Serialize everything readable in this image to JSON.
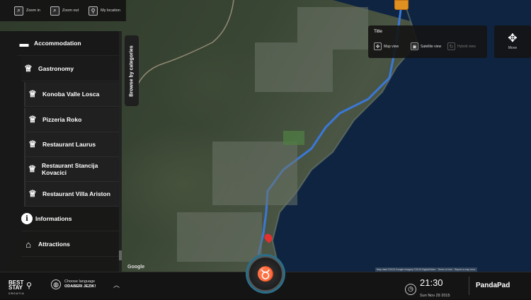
{
  "toolbar": {
    "zoom_in_label": "Zoom in",
    "zoom_out_label": "Zoom out",
    "my_location_label": "My location"
  },
  "sidebar": {
    "items": [
      {
        "label": "Accommodation",
        "icon": "bed-icon",
        "glyph": "🛏"
      },
      {
        "label": "Gastronomy",
        "icon": "chef-hat-icon",
        "glyph": "♕"
      },
      {
        "label": "Konoba Valle Losca",
        "icon": "chef-hat-icon",
        "glyph": "♕"
      },
      {
        "label": "Pizzeria Roko",
        "icon": "chef-hat-icon",
        "glyph": "♕"
      },
      {
        "label": "Restaurant Laurus",
        "icon": "chef-hat-icon",
        "glyph": "♕"
      },
      {
        "label": "Restaurant Stancija Kovacici",
        "icon": "chef-hat-icon",
        "glyph": "♕"
      },
      {
        "label": "Restaurant Villa Ariston",
        "icon": "chef-hat-icon",
        "glyph": "♕"
      },
      {
        "label": "Informations",
        "icon": "info-icon",
        "glyph": "i"
      },
      {
        "label": "Attractions",
        "icon": "museum-icon",
        "glyph": "🏛"
      }
    ],
    "browse_label": "Browse by categories"
  },
  "view_panel": {
    "title": "Title",
    "map_view": "Map view",
    "satellite_view": "Satellite view",
    "hybrid_view": "Hybrid view"
  },
  "move_label": "Move",
  "map": {
    "google_label": "Google",
    "credits": "Map data ©2015 Google Imagery ©2015 DigitalGlobe · Terms of Use · Report a map error"
  },
  "footer": {
    "logo_main": "BEST STAY",
    "logo_sub": "CROATIA",
    "lang_line1": "Choose language",
    "lang_line2": "ODABERI JEZIK!",
    "time": "21:30",
    "date": "Sun Nov 29 2015",
    "brand": "PandaPad"
  },
  "colors": {
    "route": "#3a78d8",
    "sea": "#0f2440",
    "marker": "#e09020",
    "pin": "#e53030",
    "ring": "#2a6f8a"
  }
}
